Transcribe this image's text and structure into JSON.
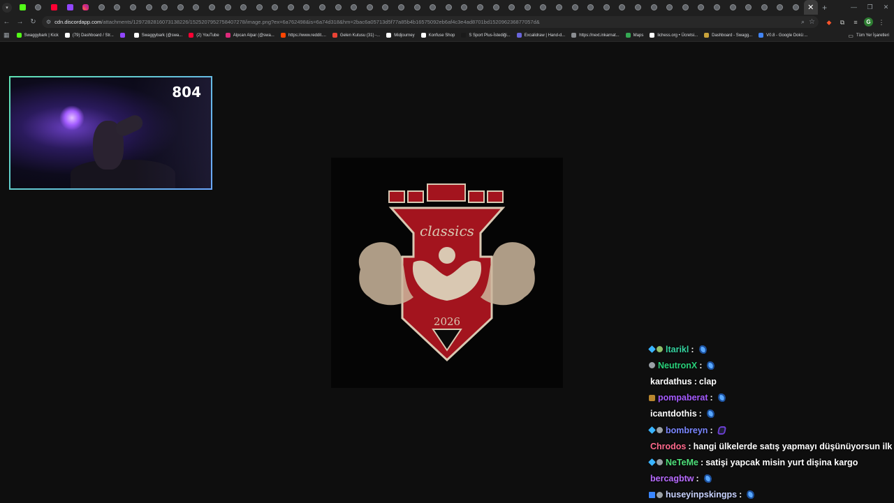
{
  "browser": {
    "tabs": [
      {
        "icon": "kick-icon"
      },
      {
        "icon": "globe-icon"
      },
      {
        "icon": "youtube-icon"
      },
      {
        "icon": "twitch-icon"
      },
      {
        "icon": "instagram-icon"
      },
      {
        "icon": "globe-icon"
      },
      {
        "icon": "globe-icon"
      },
      {
        "icon": "globe-icon"
      },
      {
        "icon": "globe-icon"
      },
      {
        "icon": "globe-icon"
      },
      {
        "icon": "globe-icon"
      },
      {
        "icon": "globe-icon"
      },
      {
        "icon": "globe-icon"
      },
      {
        "icon": "globe-icon"
      },
      {
        "icon": "globe-icon"
      },
      {
        "icon": "globe-icon"
      },
      {
        "icon": "globe-icon"
      },
      {
        "icon": "globe-icon"
      },
      {
        "icon": "globe-icon"
      },
      {
        "icon": "globe-icon"
      },
      {
        "icon": "globe-icon"
      },
      {
        "icon": "globe-icon"
      },
      {
        "icon": "globe-icon"
      },
      {
        "icon": "globe-icon"
      },
      {
        "icon": "globe-icon"
      },
      {
        "icon": "globe-icon"
      },
      {
        "icon": "globe-icon"
      },
      {
        "icon": "globe-icon"
      },
      {
        "icon": "globe-icon"
      },
      {
        "icon": "globe-icon"
      },
      {
        "icon": "globe-icon"
      },
      {
        "icon": "globe-icon"
      },
      {
        "icon": "globe-icon"
      },
      {
        "icon": "globe-icon"
      },
      {
        "icon": "globe-icon"
      },
      {
        "icon": "globe-icon"
      },
      {
        "icon": "globe-icon"
      },
      {
        "icon": "globe-icon"
      },
      {
        "icon": "globe-icon"
      },
      {
        "icon": "globe-icon"
      },
      {
        "icon": "globe-icon"
      },
      {
        "icon": "globe-icon"
      },
      {
        "icon": "globe-icon"
      },
      {
        "icon": "globe-icon"
      },
      {
        "icon": "globe-icon"
      },
      {
        "icon": "globe-icon"
      },
      {
        "icon": "globe-icon"
      },
      {
        "icon": "globe-icon"
      },
      {
        "icon": "globe-icon"
      },
      {
        "icon": "globe-icon"
      }
    ],
    "active_tab_close": "✕",
    "new_tab": "+",
    "url": {
      "host": "cdn.discordapp.com",
      "path": "/attachments/1297282816073138226/1525207952758407278/image.png?ex=6a762498&is=6a74d318&hm=2bac6a05713d5f77a85b4b16575092eb6af4c3e4ad8701bd152096236877057d&"
    }
  },
  "bookmarks": [
    {
      "label": "Swaggybark | Kick",
      "color": "#53fc18"
    },
    {
      "label": "(79) Dashboard / Str...",
      "color": "#ffffff"
    },
    {
      "label": "",
      "color": "#9146ff"
    },
    {
      "label": "Swaggybark (@swa...",
      "color": "#ffffff"
    },
    {
      "label": "(2) YouTube",
      "color": "#ff0033"
    },
    {
      "label": "Alpcan Alpar (@swa...",
      "color": "#dd2a7b"
    },
    {
      "label": "https://www.reddit....",
      "color": "#ff4500"
    },
    {
      "label": "Gelen Kutusu (31) -...",
      "color": "#ea4335"
    },
    {
      "label": "Midjourney",
      "color": "#ffffff"
    },
    {
      "label": "Konfuse Shop",
      "color": "#ffffff"
    },
    {
      "label": "S Sport Plus-İstediği...",
      "color": "#1a1a1a"
    },
    {
      "label": "Excalidraw | Hand-d...",
      "color": "#6965db"
    },
    {
      "label": "https://next.inkarnat...",
      "color": "#8a8d91"
    },
    {
      "label": "Maps",
      "color": "#34a853"
    },
    {
      "label": "lichess.org • Ücretsi...",
      "color": "#ffffff"
    },
    {
      "label": "Dashboard - Swagg...",
      "color": "#c9a33b"
    },
    {
      "label": "V0.8 - Google Doküː...",
      "color": "#4285f4"
    }
  ],
  "all_bookmarks_label": "Tüm Yer İşaretleri",
  "webcam": {
    "viewer_count": "804"
  },
  "image": {
    "crest_text": "classics",
    "crest_year": "2026",
    "colors": {
      "red": "#a3141e",
      "cream": "#d9c8b2"
    }
  },
  "chat": [
    {
      "badges": [
        "gem",
        "sub"
      ],
      "username": "ltarikl",
      "color": "#35d4a0",
      "message": "",
      "emote": "emote"
    },
    {
      "badges": [
        "mod"
      ],
      "username": "NeutronX",
      "color": "#29d17a",
      "message": "",
      "emote": "emote"
    },
    {
      "badges": [],
      "username": "kardathus",
      "color": "#ffffff",
      "message": "clap",
      "emote": ""
    },
    {
      "badges": [
        "gift"
      ],
      "username": "pompaberat",
      "color": "#a55bff",
      "message": "",
      "emote": "emote"
    },
    {
      "badges": [],
      "username": "icantdothis",
      "color": "#ffffff",
      "message": "",
      "emote": "emote"
    },
    {
      "badges": [
        "gem",
        "mod"
      ],
      "username": "bombreyn",
      "color": "#7a86ff",
      "message": "",
      "emote": "dark"
    },
    {
      "badges": [],
      "username": "Chrodos",
      "color": "#ff6a8d",
      "message": "hangi ülkelerde satış yapmayı düşünüyorsun ilk",
      "emote": ""
    },
    {
      "badges": [
        "gem",
        "mod"
      ],
      "username": "NeTeMe",
      "color": "#4ee07a",
      "message": "satişi yapcak misin yurt dişina kargo",
      "emote": ""
    },
    {
      "badges": [],
      "username": "bercagbtw",
      "color": "#b86bff",
      "message": "",
      "emote": "emote"
    },
    {
      "badges": [
        "vip",
        "mod"
      ],
      "username": "huseyinpskingps",
      "color": "#c9d3ff",
      "message": "",
      "emote": "emote"
    }
  ]
}
